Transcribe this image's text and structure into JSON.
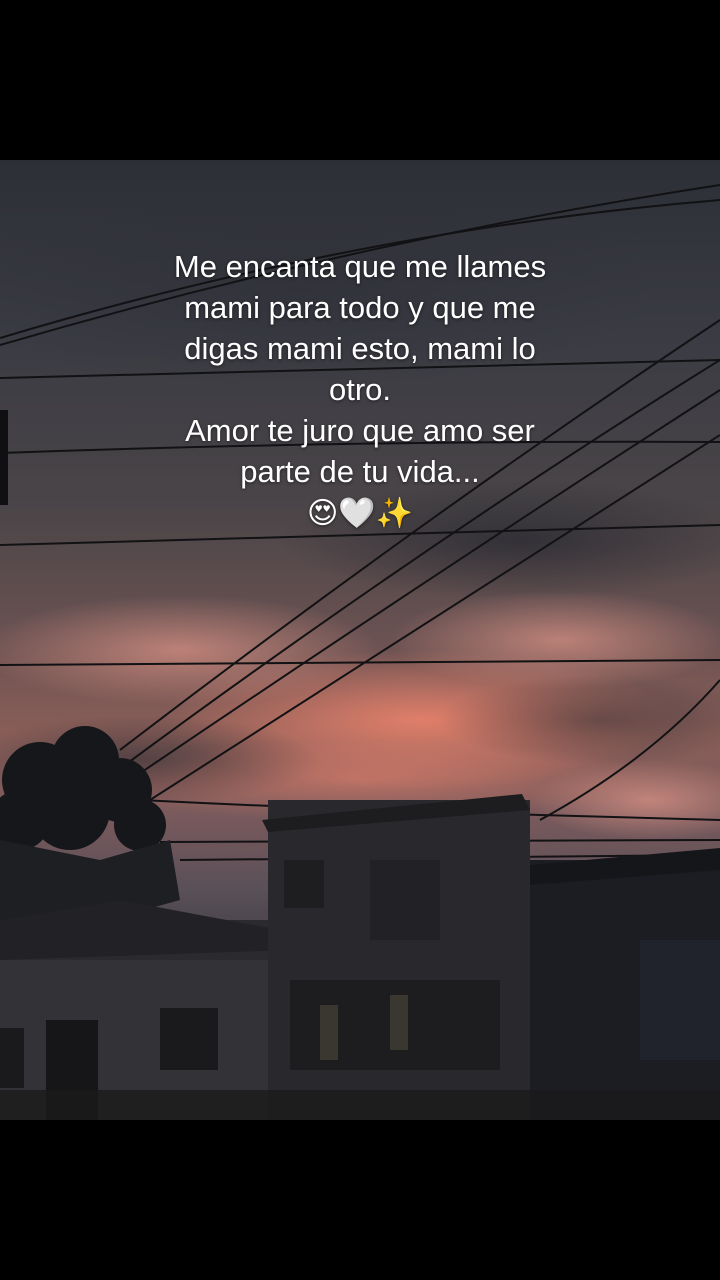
{
  "caption": {
    "lines": [
      "Me encanta que me llames",
      "mami para todo y que me",
      "digas mami esto, mami lo",
      "otro.",
      "Amor te juro que amo ser",
      "parte de tu vida..."
    ],
    "emoji": "😍🤍✨"
  },
  "photo": {
    "subject": "sunset sky over rooftops with power lines",
    "sky_colors": [
      "#2d2f37",
      "#6b5252",
      "#e07a6a",
      "#2a2a2e"
    ]
  }
}
